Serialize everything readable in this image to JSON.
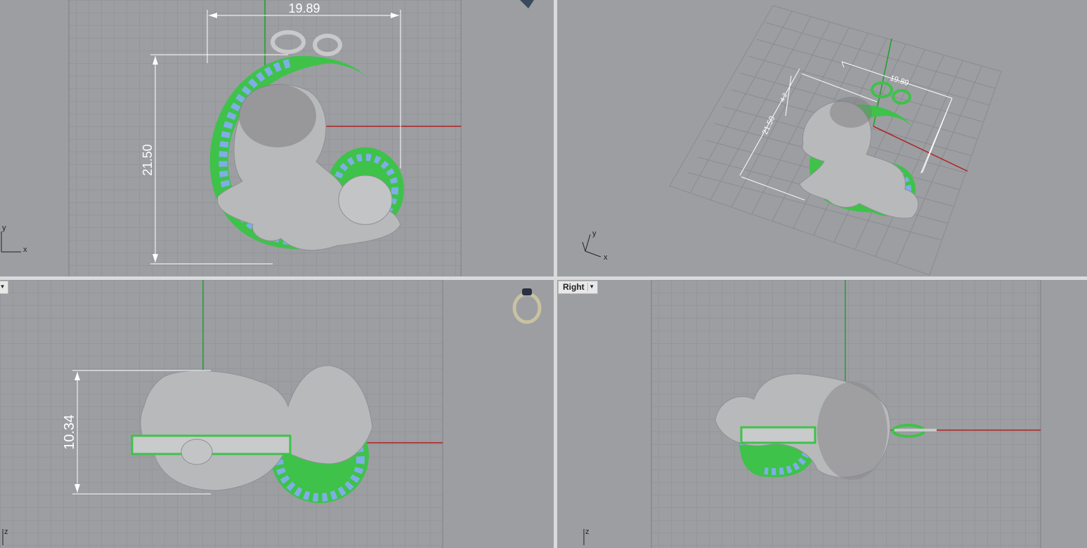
{
  "viewports": {
    "top": {
      "name": "",
      "dim_width": "19.89",
      "dim_height": "21.50",
      "axis_x": "x",
      "axis_y": "y"
    },
    "perspective": {
      "name": "",
      "dim_width": "19.89",
      "dim_height": "21.50",
      "dim_small": "4.2",
      "axis_x": "x",
      "axis_y": "y"
    },
    "front": {
      "name": "",
      "dim_height": "10.34",
      "axis_z": "z"
    },
    "right": {
      "name": "Right",
      "axis_z": "z"
    }
  },
  "colors": {
    "grid_bg": "#9c9ea2",
    "grid_line": "#8e9095",
    "axis_red": "#b02020",
    "axis_green": "#1fa02a",
    "model_gray": "#b8b9bb",
    "gem_blue": "#7faee6",
    "prong_green": "#3ec24a",
    "dim_white": "#ffffff"
  }
}
